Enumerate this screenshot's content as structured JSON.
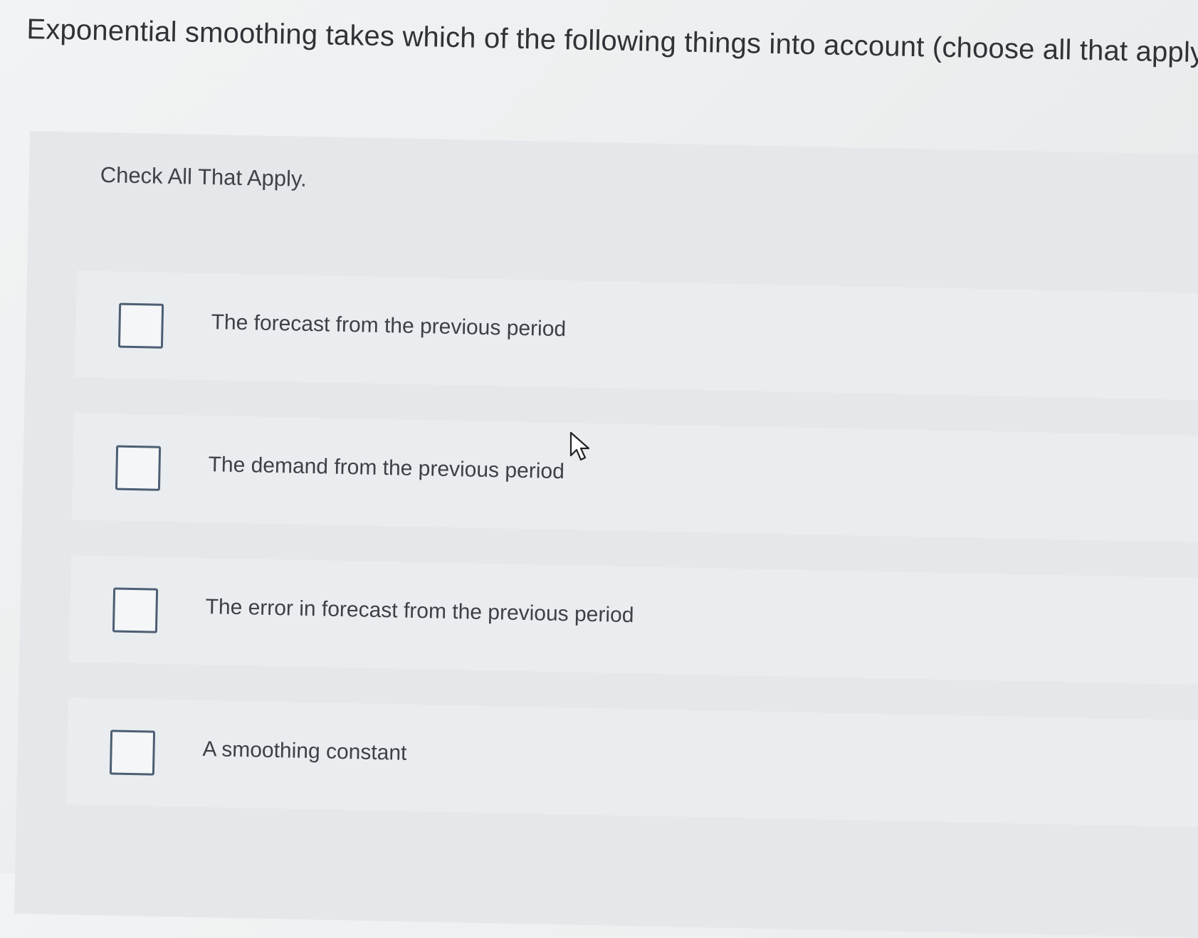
{
  "question": {
    "text": "Exponential smoothing takes which of the following things into account (choose all that apply)?"
  },
  "instruction": {
    "text": "Check All That Apply."
  },
  "options": [
    {
      "label": "The forecast from the previous period",
      "checked": false
    },
    {
      "label": "The demand from the previous period",
      "checked": false
    },
    {
      "label": "The error in forecast from the previous period",
      "checked": false
    },
    {
      "label": "A smoothing constant",
      "checked": false
    }
  ],
  "colors": {
    "checkbox_border": "#4d5e74",
    "text": "#3d4146",
    "panel": "#e5e8ea"
  },
  "icons": {
    "cursor": "mouse-pointer-icon"
  }
}
